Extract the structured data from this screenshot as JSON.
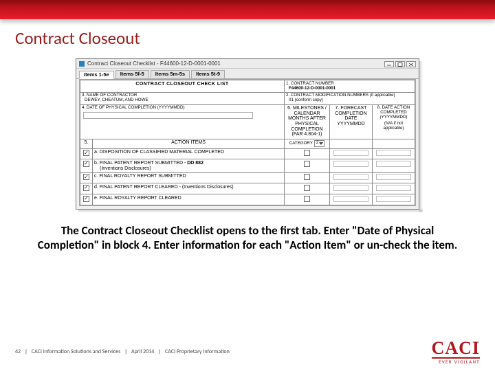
{
  "slide": {
    "title": "Contract Closeout",
    "caption": "The Contract Closeout Checklist opens to the first tab. Enter \"Date of Physical Completion\" in block 4. Enter information for each \"Action Item\" or un-check the item.",
    "page_number": "42",
    "footer_unit": "CACI Information Solutions and Services",
    "footer_date": "April 2014",
    "footer_class": "CACI Proprietary Information",
    "logo_main": "CACI",
    "logo_sub": "EVER VIGILANT"
  },
  "app": {
    "window_title": "Contract Closeout Checklist - F44600-12-D-0001-0001",
    "tabs": [
      {
        "label": "Items 1-5e"
      },
      {
        "label": "Items 5f-5"
      },
      {
        "label": "Items 5m-5s"
      },
      {
        "label": "Items 5t-9"
      }
    ],
    "form": {
      "form_title": "CONTRACT CLOSEOUT CHECK LIST",
      "block1_label": "1. CONTRACT NUMBER",
      "block1_value": "F44600-12-D-0001-0001",
      "block2_label": "2. CONTRACT MODIFICATION NUMBERS (if applicable)",
      "block2_value": "01    (conform copy)",
      "block3_label": "3. NAME OF CONTRACTOR",
      "block3_value": "DEWEY, CHEATUM, AND HOWE",
      "block4_label": "4. DATE OF PHYSICAL COMPLETION (YYYYMMDD)",
      "col6_label": "6. MILESTONES / CALENDAR MONTHS AFTER PHYSICAL COMPLETION (FAR 4.804-1)",
      "col7_label": "7. FORECAST COMPLETION DATE YYYYMMDD",
      "col8_label": "8. DATE ACTION COMPLETED (YYYYMMDD)",
      "col8_sub": "(N/A if not applicable)",
      "block5_label": "5.",
      "action_items_label": "ACTION ITEMS",
      "category_label": "CATEGORY",
      "category_value": "2",
      "rows": [
        {
          "id": "a",
          "text": "a. DISPOSITION OF CLASSIFIED MATERIAL COMPLETED",
          "checked": true,
          "note": ""
        },
        {
          "id": "b",
          "text": "b. FINAL PATENT REPORT SUBMITTED -",
          "checked": true,
          "note": "DD 882",
          "sub": "(Inventions Disclosures)"
        },
        {
          "id": "c",
          "text": "c. FINAL ROYALTY REPORT SUBMITTED",
          "checked": true,
          "note": ""
        },
        {
          "id": "d",
          "text": "d. FINAL PATENT REPORT CLEARED - (Inventions Disclosures)",
          "checked": true,
          "note": ""
        },
        {
          "id": "e",
          "text": "e. FINAL ROYALTY REPORT CLEARED",
          "checked": true,
          "note": ""
        }
      ]
    }
  }
}
